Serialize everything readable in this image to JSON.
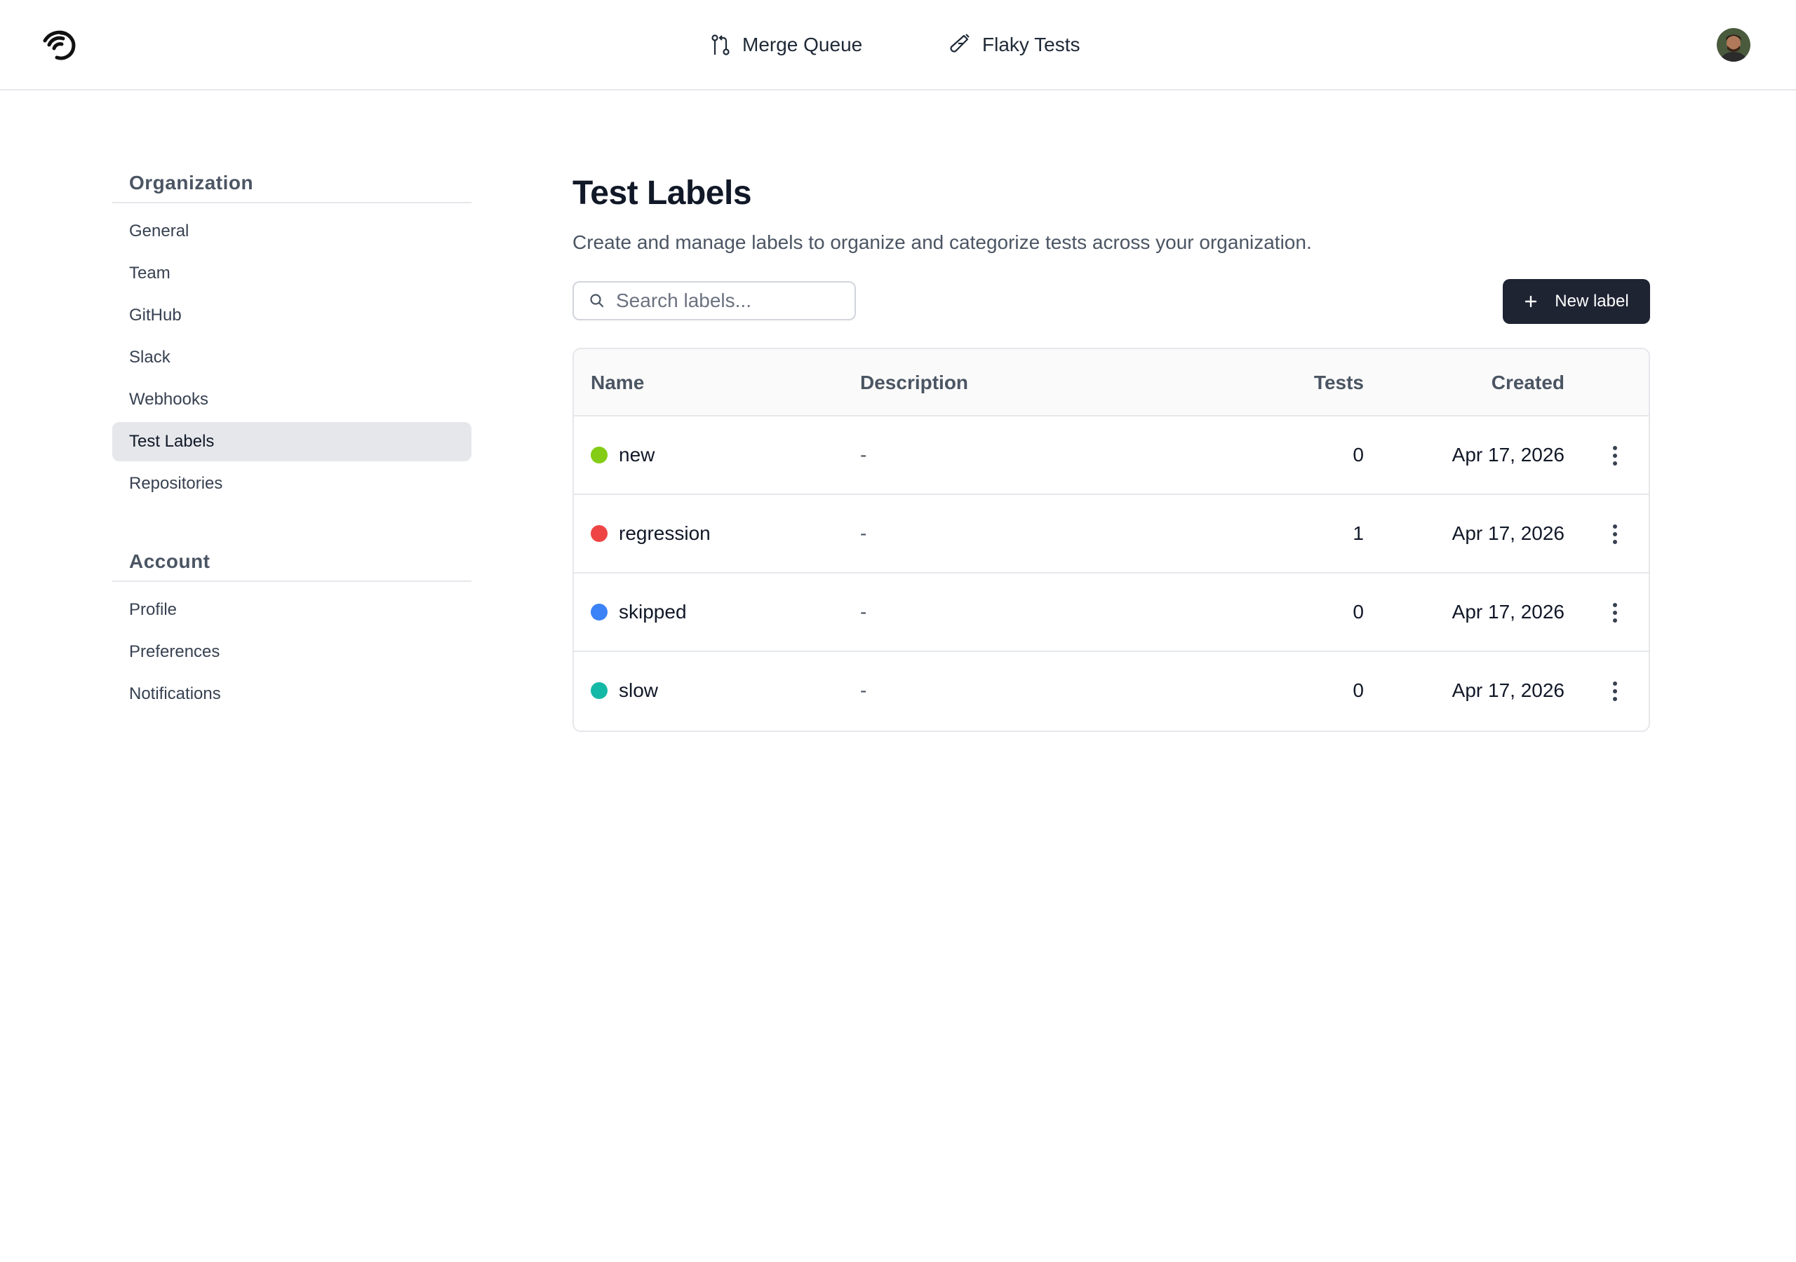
{
  "nav": {
    "merge_queue": "Merge Queue",
    "flaky_tests": "Flaky Tests"
  },
  "sidebar": {
    "organization_heading": "Organization",
    "organization_items": [
      {
        "label": "General"
      },
      {
        "label": "Team"
      },
      {
        "label": "GitHub"
      },
      {
        "label": "Slack"
      },
      {
        "label": "Webhooks"
      },
      {
        "label": "Test Labels",
        "active": true
      },
      {
        "label": "Repositories"
      }
    ],
    "account_heading": "Account",
    "account_items": [
      {
        "label": "Profile"
      },
      {
        "label": "Preferences"
      },
      {
        "label": "Notifications"
      }
    ]
  },
  "main": {
    "title": "Test Labels",
    "description": "Create and manage labels to organize and categorize tests across your organization.",
    "search_placeholder": "Search labels...",
    "new_label_button": "New label"
  },
  "table": {
    "columns": {
      "name": "Name",
      "description": "Description",
      "tests": "Tests",
      "created": "Created"
    },
    "rows": [
      {
        "name": "new",
        "color": "#84cc16",
        "description": "-",
        "tests": "0",
        "created": "Apr 17, 2026"
      },
      {
        "name": "regression",
        "color": "#ef4444",
        "description": "-",
        "tests": "1",
        "created": "Apr 17, 2026"
      },
      {
        "name": "skipped",
        "color": "#3b82f6",
        "description": "-",
        "tests": "0",
        "created": "Apr 17, 2026"
      },
      {
        "name": "slow",
        "color": "#14b8a6",
        "description": "-",
        "tests": "0",
        "created": "Apr 17, 2026"
      }
    ]
  },
  "colors": {
    "primary_button": "#1f2433",
    "active_sidebar_bg": "#e5e7eb"
  },
  "icons": {
    "logo": "radar-logo-icon",
    "merge_queue": "git-pull-request-icon",
    "flaky_tests": "test-tube-icon",
    "search": "search-icon",
    "new_label": "plus-icon",
    "row_menu": "more-vertical-icon"
  }
}
